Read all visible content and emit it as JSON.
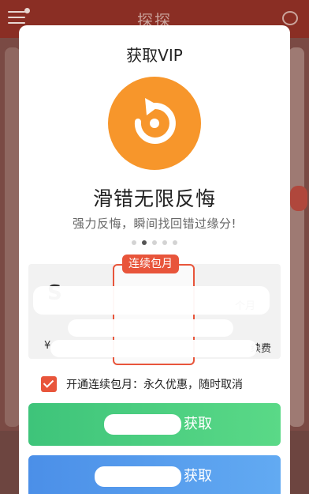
{
  "background": {
    "title": "探探",
    "menu_icon": "menu-icon",
    "chat_icon": "chat-icon"
  },
  "modal": {
    "title": "获取VIP",
    "feature_icon": "undo-arrow-icon",
    "feature_title": "滑错无限反悔",
    "feature_desc": "强力反悔，瞬间找回错过缘分!",
    "carousel": {
      "count": 5,
      "active_index": 1
    },
    "plans": {
      "badge": "连续包月",
      "left_price_partial": "S",
      "right_unit_partial": "个月",
      "bottom_left_partial": "¥",
      "bottom_right_partial": "续费"
    },
    "agreement": {
      "checked": true,
      "label": "开通连续包月：永久优惠，随时取消"
    },
    "buttons": {
      "primary_suffix": "获取",
      "secondary_suffix": "获取"
    }
  },
  "colors": {
    "accent_orange": "#f7962b",
    "accent_red": "#e8553b",
    "button_green": "#4fd081",
    "button_blue": "#57a0ee"
  }
}
